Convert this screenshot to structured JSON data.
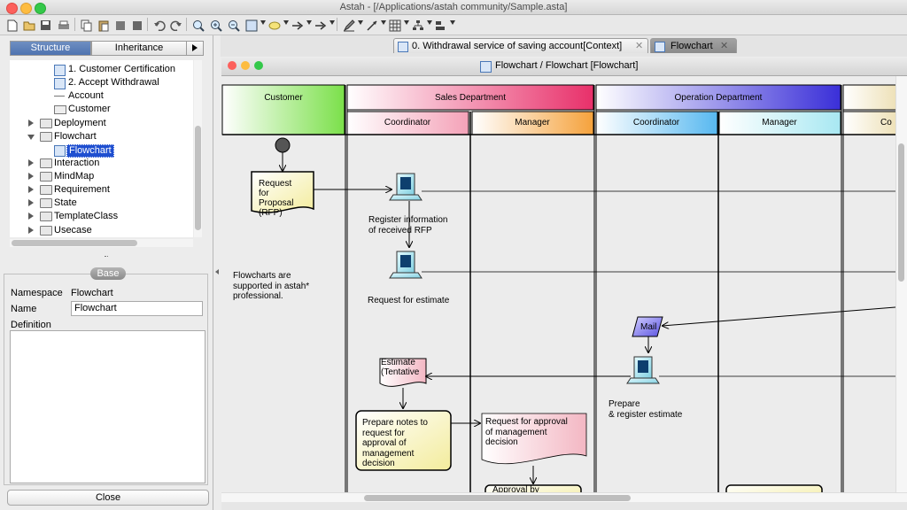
{
  "window": {
    "title": "Astah - [/Applications/astah community/Sample.asta]"
  },
  "colors": {
    "close": "#fc605c",
    "minimize": "#fdbc40",
    "zoom": "#34c84a",
    "selection": "#1f4fd0",
    "customer_lane": "#7be04a",
    "sales_lane": "#e8306a",
    "operation_lane": "#3a2fd8"
  },
  "toolbar": {
    "icons": [
      "new-icon",
      "open-icon",
      "save-icon",
      "print-icon",
      "copy-icon",
      "paste-icon",
      "cut-icon",
      "delete-icon",
      "undo-icon",
      "redo-icon",
      "zoom-fit-icon",
      "zoom-in-icon",
      "zoom-out-icon",
      "fit-window-icon",
      "note-icon",
      "arrow-right-icon",
      "pen-icon",
      "line-icon",
      "grid-icon",
      "tree-icon",
      "align-icon"
    ]
  },
  "left_panel": {
    "tabs": [
      "Structure",
      "Inheritance"
    ],
    "tree": [
      {
        "label": "1. Customer Certification",
        "type": "diagram",
        "depth": 2
      },
      {
        "label": "2. Accept Withdrawal",
        "type": "diagram",
        "depth": 2
      },
      {
        "label": "Account",
        "type": "class",
        "depth": 2
      },
      {
        "label": "Customer",
        "type": "class",
        "depth": 2
      },
      {
        "label": "Deployment",
        "type": "folder",
        "depth": 1,
        "expanded": false
      },
      {
        "label": "Flowchart",
        "type": "folder",
        "depth": 1,
        "expanded": true
      },
      {
        "label": "Flowchart",
        "type": "diagram",
        "depth": 2,
        "selected": true
      },
      {
        "label": "Interaction",
        "type": "folder",
        "depth": 1,
        "expanded": false
      },
      {
        "label": "MindMap",
        "type": "folder",
        "depth": 1,
        "expanded": false
      },
      {
        "label": "Requirement",
        "type": "folder",
        "depth": 1,
        "expanded": false
      },
      {
        "label": "State",
        "type": "folder",
        "depth": 1,
        "expanded": false
      },
      {
        "label": "TemplateClass",
        "type": "folder",
        "depth": 1,
        "expanded": false
      },
      {
        "label": "Usecase",
        "type": "folder",
        "depth": 1,
        "expanded": false
      }
    ],
    "properties": {
      "tab": "Base",
      "namespace_label": "Namespace",
      "namespace_value": "Flowchart",
      "name_label": "Name",
      "name_value": "Flowchart",
      "definition_label": "Definition",
      "definition_value": ""
    },
    "close_button": "Close"
  },
  "editor": {
    "tabs": [
      {
        "label": "0. Withdrawal service of saving account[Context]",
        "active": false
      },
      {
        "label": "Flowchart",
        "active": true
      }
    ],
    "diagram_title": "Flowchart / Flowchart [Flowchart]"
  },
  "diagram": {
    "lanes": {
      "customer": "Customer",
      "sales": "Sales Department",
      "operation": "Operation Department",
      "sales_coordinator": "Coordinator",
      "sales_manager": "Manager",
      "op_coordinator": "Coordinator",
      "op_manager": "Manager",
      "cut_off": "Co"
    },
    "note": [
      "Flowcharts are",
      "supported in astah*",
      "professional."
    ],
    "rfp": [
      "Request",
      "for",
      "Proposal",
      "(RFP)"
    ],
    "register": [
      "Register information",
      "of received RFP"
    ],
    "request_estimate": "Request for estimate",
    "mail": "Mail",
    "estimate_tentative": [
      "Estimate",
      "(Tentative"
    ],
    "prepare_register": [
      "Prepare",
      "& register estimate"
    ],
    "prepare_notes": [
      "Prepare notes to",
      "request for",
      "approval of",
      "management",
      "decision"
    ],
    "request_approval": [
      "Request  for approval",
      "of management",
      "decision"
    ],
    "approval_cut": "Approval by"
  }
}
